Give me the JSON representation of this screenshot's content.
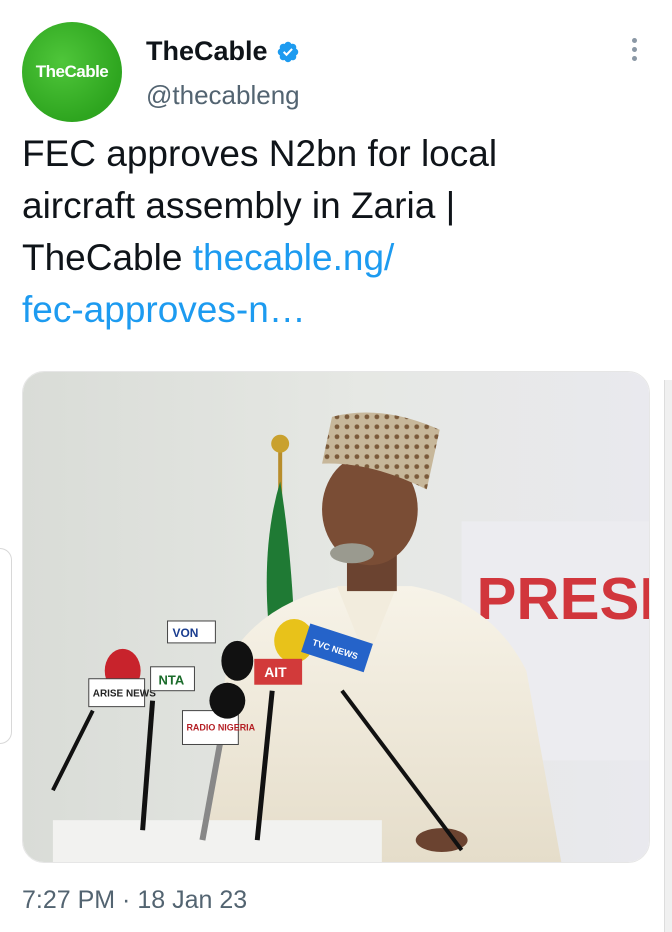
{
  "account": {
    "avatar_text": "TheCable",
    "display_name": "TheCable",
    "handle": "@thecableng",
    "verified": true
  },
  "tweet": {
    "text_line1": "FEC approves N2bn for local",
    "text_line2": "aircraft assembly in Zaria |",
    "text_line3_prefix": "TheCable ",
    "link_part1": "thecable.ng/",
    "link_part2": "fec-approves-n…"
  },
  "media": {
    "backdrop_text": "PRESI",
    "mic_labels": [
      "VON",
      "ARISE NEWS",
      "NTA",
      "AIT",
      "TVC NEWS",
      "RADIO NIGERIA"
    ]
  },
  "meta": {
    "timestamp": "7:27 PM · 18 Jan 23"
  },
  "colors": {
    "link": "#1d9bf0",
    "verified": "#1d9bf0",
    "avatar": "#34b024",
    "secondary_text": "#536471"
  },
  "icons": [
    "verified-badge-icon",
    "more-options-icon"
  ]
}
